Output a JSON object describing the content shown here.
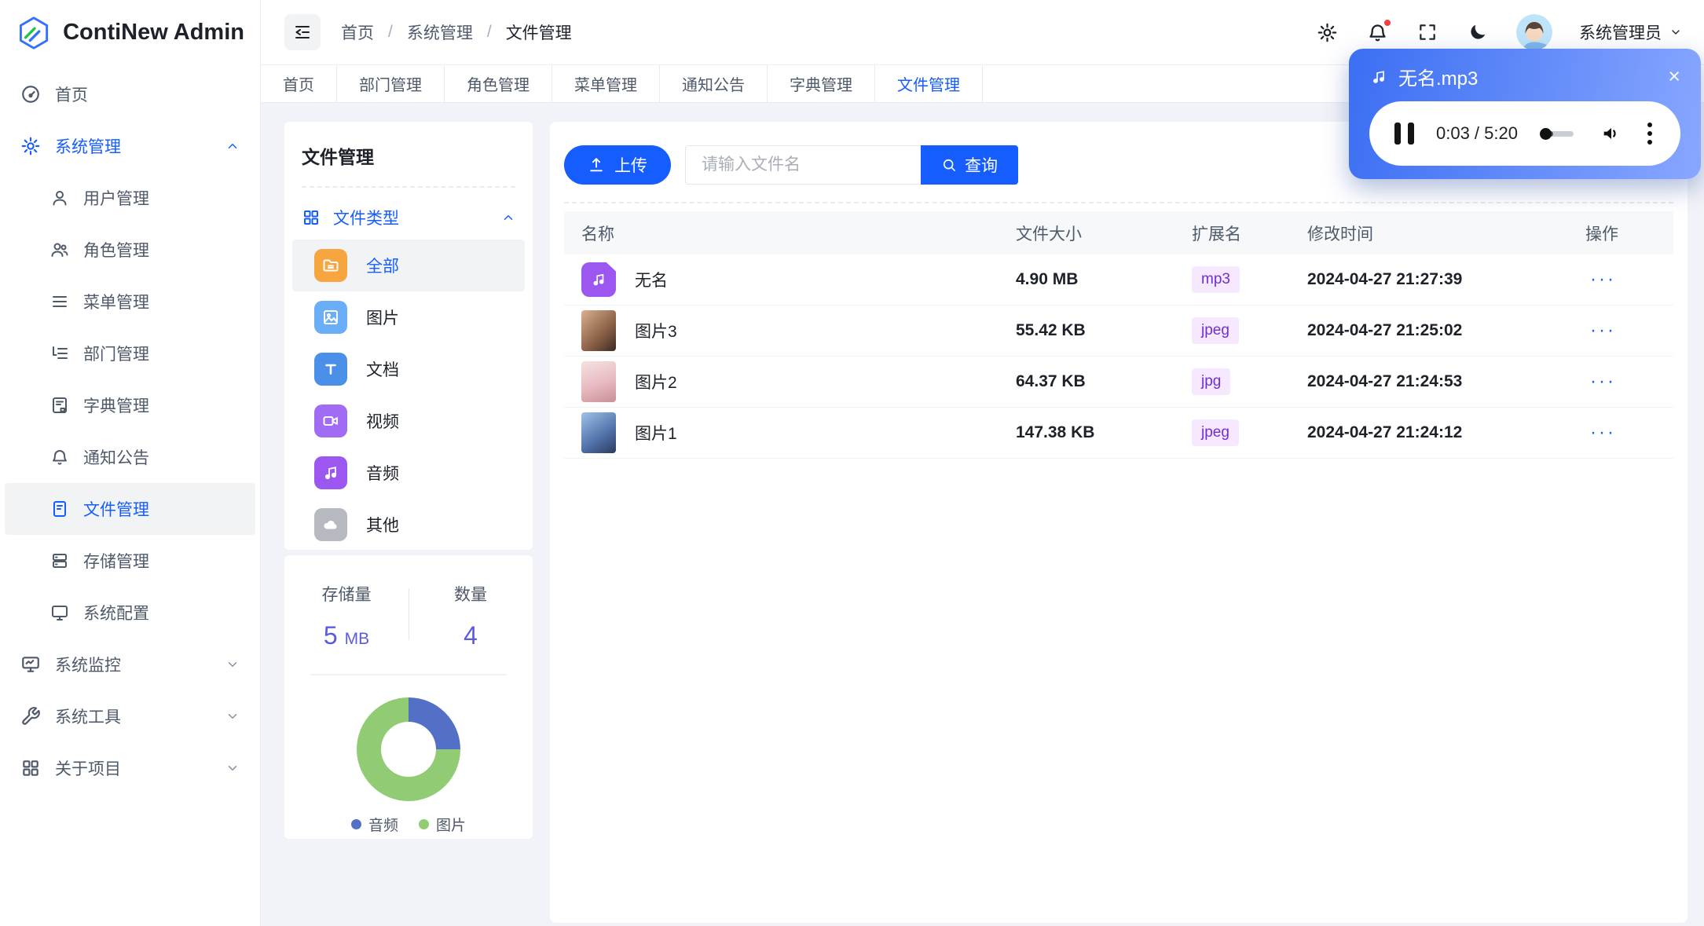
{
  "app": {
    "name": "ContiNew Admin"
  },
  "breadcrumb": {
    "separator": "/",
    "items": [
      "首页",
      "系统管理",
      "文件管理"
    ]
  },
  "userbar": {
    "name": "系统管理员"
  },
  "tabs": [
    {
      "label": "首页"
    },
    {
      "label": "部门管理"
    },
    {
      "label": "角色管理"
    },
    {
      "label": "菜单管理"
    },
    {
      "label": "通知公告"
    },
    {
      "label": "字典管理"
    },
    {
      "label": "文件管理",
      "active": true
    }
  ],
  "sidebar": {
    "items": [
      {
        "label": "首页"
      },
      {
        "label": "系统管理",
        "expanded": true
      },
      {
        "label": "用户管理"
      },
      {
        "label": "角色管理"
      },
      {
        "label": "菜单管理"
      },
      {
        "label": "部门管理"
      },
      {
        "label": "字典管理"
      },
      {
        "label": "通知公告"
      },
      {
        "label": "文件管理",
        "active": true
      },
      {
        "label": "存储管理"
      },
      {
        "label": "系统配置"
      },
      {
        "label": "系统监控",
        "collapsed": true
      },
      {
        "label": "系统工具",
        "collapsed": true
      },
      {
        "label": "关于项目",
        "collapsed": true
      }
    ]
  },
  "file_panel": {
    "title": "文件管理",
    "group_label": "文件类型",
    "types": [
      {
        "label": "全部",
        "selected": true
      },
      {
        "label": "图片"
      },
      {
        "label": "文档"
      },
      {
        "label": "视频"
      },
      {
        "label": "音频"
      },
      {
        "label": "其他"
      }
    ]
  },
  "stats": {
    "storage_label": "存储量",
    "storage_value": "5",
    "storage_unit": "MB",
    "count_label": "数量",
    "count_value": "4"
  },
  "chart_data": {
    "type": "pie",
    "labels": [
      "音频",
      "图片"
    ],
    "values": [
      1,
      3
    ],
    "percents": [
      25,
      75
    ],
    "colors": [
      "#5470c6",
      "#91cc75"
    ],
    "donut": true,
    "legend_position": "bottom"
  },
  "toolbar": {
    "upload_label": "上传",
    "search_placeholder": "请输入文件名",
    "search_label": "查询"
  },
  "table": {
    "columns": [
      "名称",
      "文件大小",
      "扩展名",
      "修改时间",
      "操作"
    ],
    "rows": [
      {
        "name": "无名",
        "size": "4.90 MB",
        "ext": "mp3",
        "time": "2024-04-27 21:27:39",
        "action": "···"
      },
      {
        "name": "图片3",
        "size": "55.42 KB",
        "ext": "jpeg",
        "time": "2024-04-27 21:25:02",
        "action": "···"
      },
      {
        "name": "图片2",
        "size": "64.37 KB",
        "ext": "jpg",
        "time": "2024-04-27 21:24:53",
        "action": "···"
      },
      {
        "name": "图片1",
        "size": "147.38 KB",
        "ext": "jpeg",
        "time": "2024-04-27 21:24:12",
        "action": "···"
      }
    ]
  },
  "player": {
    "title": "无名.mp3",
    "time_display": "0:03 / 5:20",
    "close_glyph": "×"
  },
  "colors": {
    "primary": "#165dff",
    "stat_value": "#5a5cde",
    "ext_badge_bg": "#f5e8ff",
    "ext_badge_text": "#722ed1",
    "pie_audio": "#5470c6",
    "pie_image": "#91cc75",
    "notification_dot": "#f53f3f",
    "player_gradient_start": "#3b6ef3",
    "player_gradient_end": "#88a7ff"
  }
}
